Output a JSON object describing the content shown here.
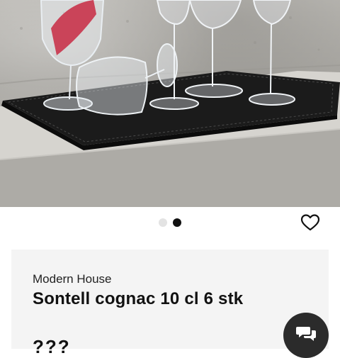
{
  "hero": {
    "image": "product-photo-cognac-glasses"
  },
  "carousel": {
    "slides": 2,
    "active": 2
  },
  "product": {
    "brand": "Modern House",
    "title": "Sontell cognac 10 cl 6 stk",
    "price_partial": "???"
  },
  "icons": {
    "favorite": "heart-outline-icon",
    "chat": "chat-bubbles-icon"
  },
  "colors": {
    "card_bg": "#f4f4f4",
    "active_dot": "#111111",
    "inactive_dot": "#e3e3e3",
    "chat_button": "#2b2b2b"
  }
}
